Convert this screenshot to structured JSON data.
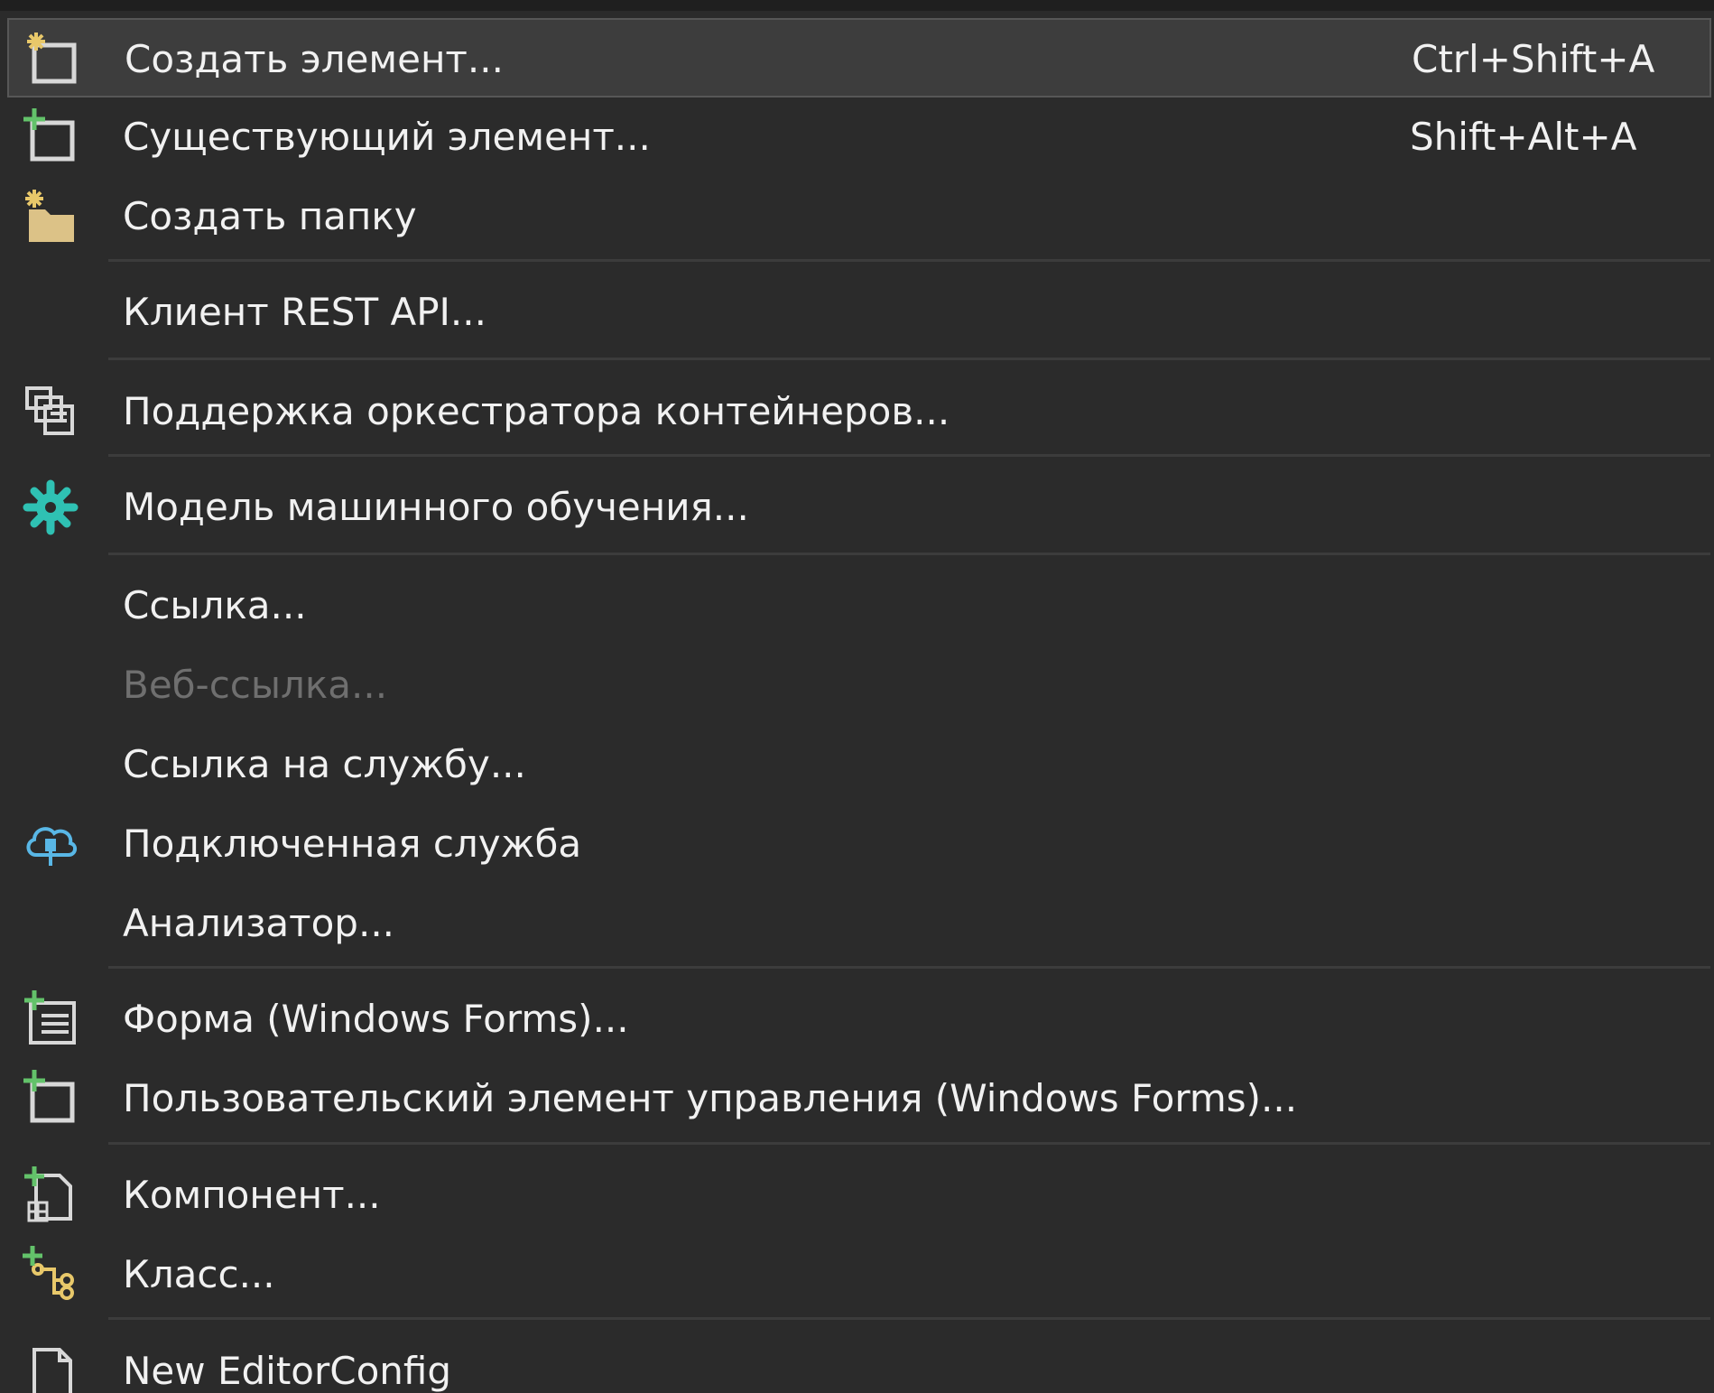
{
  "menu": {
    "items": [
      {
        "label": "Создать элемент...",
        "shortcut": "Ctrl+Shift+A",
        "icon": "new-item-icon"
      },
      {
        "label": "Существующий элемент...",
        "shortcut": "Shift+Alt+A",
        "icon": "existing-item-icon"
      },
      {
        "label": "Создать папку",
        "icon": "new-folder-icon"
      },
      {
        "label": "Клиент REST API..."
      },
      {
        "label": "Поддержка оркестратора контейнеров...",
        "icon": "container-orchestrator-icon"
      },
      {
        "label": "Модель машинного обучения...",
        "icon": "ml-model-icon"
      },
      {
        "label": "Ссылка..."
      },
      {
        "label": "Веб-ссылка...",
        "disabled": true
      },
      {
        "label": "Ссылка на службу..."
      },
      {
        "label": "Подключенная служба",
        "icon": "connected-service-icon"
      },
      {
        "label": "Анализатор..."
      },
      {
        "label": "Форма (Windows Forms)...",
        "icon": "windows-form-icon"
      },
      {
        "label": "Пользовательский элемент управления (Windows Forms)...",
        "icon": "user-control-icon"
      },
      {
        "label": "Компонент...",
        "icon": "component-icon"
      },
      {
        "label": "Класс...",
        "icon": "class-icon"
      },
      {
        "label": "New EditorConfig",
        "icon": "document-icon"
      }
    ]
  },
  "colors": {
    "background": "#2b2b2b",
    "highlight": "#3d3d3d",
    "highlight_border": "#575757",
    "text": "#f1f1f1",
    "disabled_text": "#6f6f6f",
    "separator": "#3c3c3c",
    "plus_green": "#63c26a",
    "star_yellow": "#e8c86a",
    "folder_tan": "#dcc287",
    "teal": "#2fc1b3",
    "cloud_blue": "#59b7e6"
  }
}
